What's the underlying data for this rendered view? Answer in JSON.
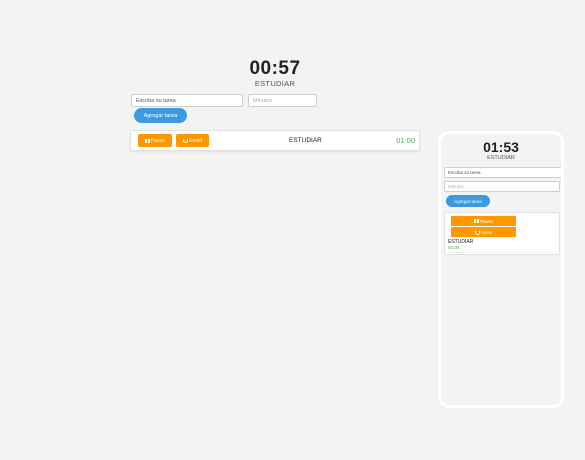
{
  "desktop": {
    "timer": "00:57",
    "current_task": "ESTUDIAR",
    "task_input": {
      "value": "",
      "placeholder": "Escriba su tarea"
    },
    "minutes_input": {
      "value": "",
      "placeholder": "Minutos"
    },
    "add_button_label": "Agregar tarea",
    "tasks": [
      {
        "pause_label": "Pause",
        "reset_label": "Reset",
        "name": "ESTUDIAR",
        "time": "01:00"
      }
    ]
  },
  "phone": {
    "timer": "01:53",
    "current_task": "ESTUDIAR",
    "task_input": {
      "value": "",
      "placeholder": "Escriba su tarea"
    },
    "minutes_input": {
      "value": "",
      "placeholder": "Minutos"
    },
    "add_button_label": "Agregar tarea",
    "tasks": [
      {
        "pause_label": "Pause",
        "reset_label": "Reset",
        "name": "ESTUDIAR",
        "time": "02:00"
      }
    ]
  },
  "colors": {
    "background": "#f3f3f3",
    "accent_blue": "#3b9be0",
    "accent_orange": "#ff9800",
    "time_green": "#4caf50"
  },
  "icons": {
    "pause": "pause-icon",
    "reset": "reset-icon"
  }
}
